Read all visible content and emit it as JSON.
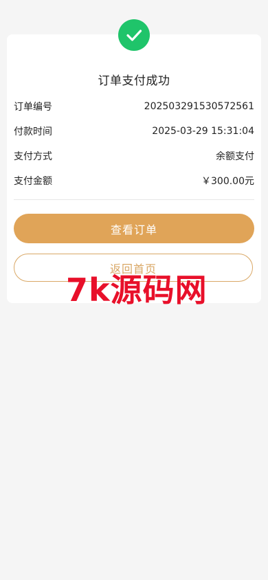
{
  "header": {
    "status_icon": "check-icon",
    "title": "订单支付成功"
  },
  "order": {
    "rows": [
      {
        "label": "订单编号",
        "value": "202503291530572561"
      },
      {
        "label": "付款时间",
        "value": "2025-03-29 15:31:04"
      },
      {
        "label": "支付方式",
        "value": "余额支付"
      },
      {
        "label": "支付金额",
        "value": "￥300.00元"
      }
    ]
  },
  "actions": {
    "primary_label": "查看订单",
    "secondary_label": "返回首页"
  },
  "watermark": {
    "text": "7k源码网"
  },
  "colors": {
    "success": "#1fc46a",
    "accent": "#e0a458",
    "outline": "#d9a765",
    "watermark": "#e8102a"
  }
}
